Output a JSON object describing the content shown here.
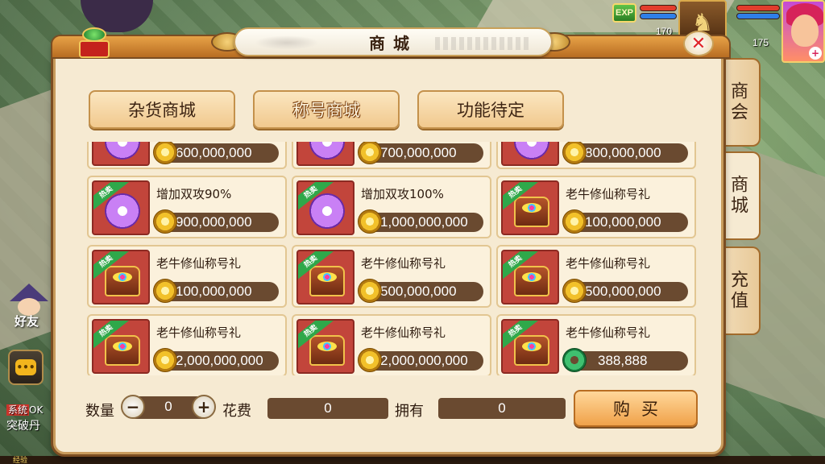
{
  "hud": {
    "exp_label": "EXP",
    "pet_level": "170",
    "hero_level": "175",
    "hero_plus": "+"
  },
  "left_hud": {
    "friend_label": "好友",
    "chat_glyph": "•••",
    "system_tag": "系统",
    "system_text": "OK",
    "system_line2": "突破丹",
    "exp_strip": "经验"
  },
  "shop": {
    "title": "商城",
    "close_glyph": "✕",
    "tabs": [
      {
        "label": "杂货商城",
        "active": false
      },
      {
        "label": "称号商城",
        "active": true
      },
      {
        "label": "功能待定",
        "active": false
      }
    ],
    "side_tabs": [
      {
        "label": "商会",
        "active": false
      },
      {
        "label": "商城",
        "active": true
      },
      {
        "label": "充值",
        "active": false
      }
    ],
    "hot_badge": "热卖",
    "items": [
      {
        "name": "",
        "price": "600,000,000",
        "icon": "scroll-icon",
        "currency": "gold-coin-icon"
      },
      {
        "name": "",
        "price": "700,000,000",
        "icon": "scroll-icon",
        "currency": "gold-coin-icon"
      },
      {
        "name": "",
        "price": "800,000,000",
        "icon": "scroll-icon",
        "currency": "gold-coin-icon"
      },
      {
        "name": "增加双攻90%",
        "price": "900,000,000",
        "icon": "scroll-icon",
        "currency": "gold-coin-icon"
      },
      {
        "name": "增加双攻100%",
        "price": "1,000,000,000",
        "icon": "scroll-icon",
        "currency": "gold-coin-icon"
      },
      {
        "name": "老牛修仙称号礼",
        "price": "100,000,000",
        "icon": "treasure-chest-icon",
        "currency": "gold-coin-icon"
      },
      {
        "name": "老牛修仙称号礼",
        "price": "100,000,000",
        "icon": "treasure-chest-icon",
        "currency": "gold-coin-icon"
      },
      {
        "name": "老牛修仙称号礼",
        "price": "500,000,000",
        "icon": "treasure-chest-icon",
        "currency": "gold-coin-icon"
      },
      {
        "name": "老牛修仙称号礼",
        "price": "500,000,000",
        "icon": "treasure-chest-icon",
        "currency": "gold-coin-icon"
      },
      {
        "name": "老牛修仙称号礼",
        "price": "2,000,000,000",
        "icon": "treasure-chest-icon",
        "currency": "gold-coin-icon"
      },
      {
        "name": "老牛修仙称号礼",
        "price": "2,000,000,000",
        "icon": "treasure-chest-icon",
        "currency": "gold-coin-icon"
      },
      {
        "name": "老牛修仙称号礼",
        "price": "388,888",
        "icon": "treasure-chest-icon",
        "currency": "jade-coin-icon"
      }
    ],
    "bottom": {
      "qty_label": "数量",
      "qty_value": "0",
      "minus": "−",
      "plus": "+",
      "cost_label": "花费",
      "cost_value": "0",
      "own_label": "拥有",
      "own_value": "0",
      "buy_label": "购买"
    }
  }
}
